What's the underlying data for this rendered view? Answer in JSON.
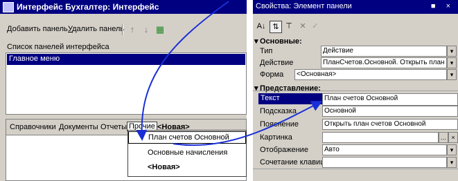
{
  "left_window": {
    "title": "Интерфейс Бухгалтер: Интерфейс",
    "toolbar": {
      "add_panel": "Добавить панель",
      "delete_panel": "Удалить панель"
    },
    "list_label": "Список панелей интерфейса",
    "list_items": [
      "Главное меню"
    ],
    "menu_bar": {
      "items": [
        "Справочники",
        "Документы",
        "Отчеты",
        "Прочие",
        "<Новая>"
      ]
    },
    "dropdown": {
      "items": [
        "План счетов Основной",
        "Основные начисления",
        "<Новая>"
      ]
    }
  },
  "right_window": {
    "title": "Свойства: Элемент панели",
    "title_buttons": "■ ×",
    "sections": {
      "basic": "Основные:",
      "presentation": "Представление:"
    },
    "props": {
      "type_label": "Тип",
      "type_value": "Действие",
      "action_label": "Действие",
      "action_value": "ПланСчетов.Основной. Открыть план счетов",
      "form_label": "Форма",
      "form_value": "<Основная>",
      "text_label": "Текст",
      "text_value": "План счетов Основной",
      "hint_label": "Подсказка",
      "hint_value": "Основной",
      "explanation_label": "Пояснение",
      "explanation_value": "Открыть план счетов Основной",
      "picture_label": "Картинка",
      "picture_value": "",
      "display_label": "Отображение",
      "display_value": "Авто",
      "shortcut_label": "Сочетание клавиш",
      "shortcut_value": ""
    },
    "toolbar_icons": [
      "sort-az-icon",
      "sort-category-icon",
      "filter-icon",
      "delete-icon",
      "check-icon"
    ]
  },
  "colors": {
    "titlebar": "#000080",
    "window_bg": "#d4d0c8",
    "arrow": "#1a2fd6"
  }
}
